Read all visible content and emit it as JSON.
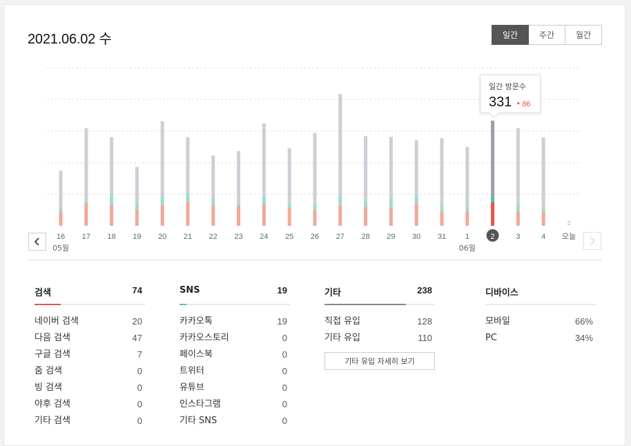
{
  "header": {
    "date": "2021.06.02 수"
  },
  "period_tabs": [
    {
      "label": "일간",
      "active": true
    },
    {
      "label": "주간",
      "active": false
    },
    {
      "label": "월간",
      "active": false
    }
  ],
  "colors": {
    "total": "#cdcfd6",
    "sns": "#9fdccd",
    "search": "#f1a998",
    "selected_total": "#9aa0a8",
    "selected_sns": "#54c0a6",
    "selected_search": "#e8544a",
    "badge": "#555555"
  },
  "chart_data": {
    "type": "bar",
    "stacked": true,
    "categories": [
      "16",
      "17",
      "18",
      "19",
      "20",
      "21",
      "22",
      "23",
      "24",
      "25",
      "26",
      "27",
      "28",
      "29",
      "30",
      "31",
      "1",
      "2",
      "3",
      "4",
      "오늘"
    ],
    "month_labels": [
      {
        "at": "16",
        "text": "05월"
      },
      {
        "at": "1",
        "text": "06월"
      }
    ],
    "series": [],
    "values_total": [
      173,
      307,
      279,
      185,
      329,
      279,
      221,
      235,
      322,
      244,
      292,
      415,
      282,
      280,
      269,
      276,
      248,
      331,
      307,
      278,
      7
    ],
    "values_sns": [
      12,
      10,
      35,
      25,
      30,
      30,
      22,
      8,
      25,
      12,
      18,
      28,
      20,
      30,
      28,
      18,
      15,
      19,
      20,
      14,
      0
    ],
    "values_search": [
      47,
      72,
      65,
      50,
      65,
      75,
      65,
      62,
      68,
      55,
      50,
      65,
      60,
      55,
      72,
      45,
      45,
      74,
      45,
      45,
      0
    ],
    "ylim": [
      0,
      500
    ],
    "grid": true,
    "selected": "2",
    "tooltip": {
      "label": "일간 방문수",
      "value": "331",
      "delta": "86"
    }
  },
  "stats": {
    "search": {
      "title": "검색",
      "count": "74",
      "items": [
        {
          "label": "네이버 검색",
          "value": "20"
        },
        {
          "label": "다음 검색",
          "value": "47"
        },
        {
          "label": "구글 검색",
          "value": "7"
        },
        {
          "label": "줌 검색",
          "value": "0"
        },
        {
          "label": "빙 검색",
          "value": "0"
        },
        {
          "label": "야후 검색",
          "value": "0"
        },
        {
          "label": "기타 검색",
          "value": "0"
        }
      ]
    },
    "sns": {
      "title": "SNS",
      "count": "19",
      "items": [
        {
          "label": "카카오톡",
          "value": "19"
        },
        {
          "label": "카카오스토리",
          "value": "0"
        },
        {
          "label": "페이스북",
          "value": "0"
        },
        {
          "label": "트위터",
          "value": "0"
        },
        {
          "label": "유튜브",
          "value": "0"
        },
        {
          "label": "인스타그램",
          "value": "0"
        },
        {
          "label": "기타 SNS",
          "value": "0"
        }
      ]
    },
    "etc": {
      "title": "기타",
      "count": "238",
      "items": [
        {
          "label": "직접 유입",
          "value": "128"
        },
        {
          "label": "기타 유입",
          "value": "110"
        }
      ],
      "more_button": "기타 유입 자세히 보기"
    },
    "device": {
      "title": "디바이스",
      "items": [
        {
          "label": "모바일",
          "value": "66%"
        },
        {
          "label": "PC",
          "value": "34%"
        }
      ]
    }
  }
}
